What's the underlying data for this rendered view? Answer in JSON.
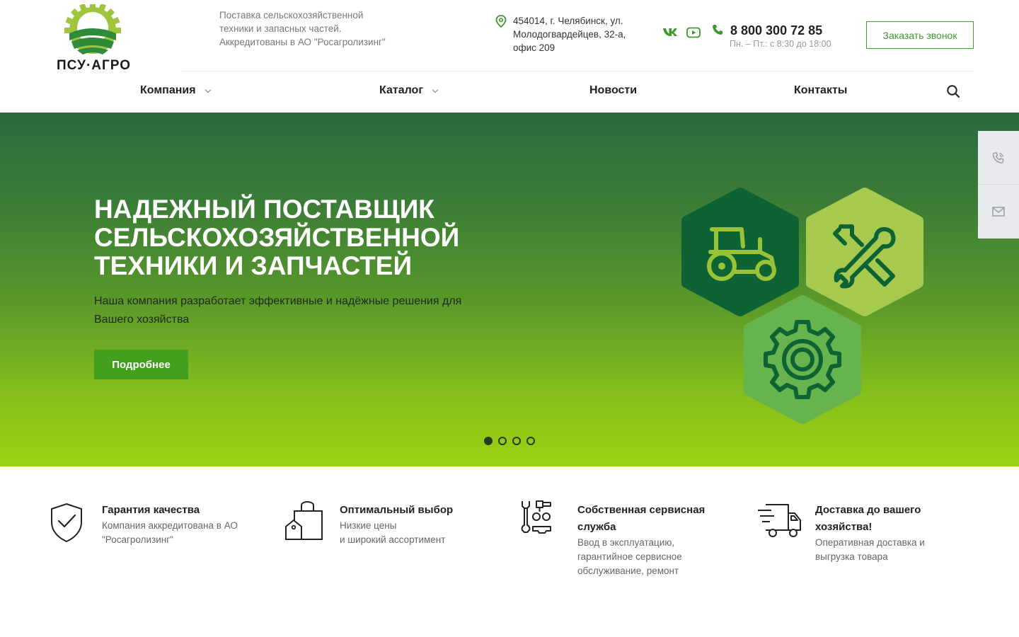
{
  "header": {
    "logo_text": "ПСУ·АГРО",
    "tagline": "Поставка сельскохозяйственной техники и запасных частей. Аккредитованы в АО \"Росагролизинг\"",
    "address": "454014, г. Челябинск, ул. Молодогвардейцев, 32-а, офис 209",
    "phone": "8 800 300 72 85",
    "hours": "Пн. – Пт.: с 8:30 до 18:00",
    "callback_label": "Заказать звонок",
    "social": [
      "vk-icon",
      "youtube-icon"
    ]
  },
  "nav": {
    "items": [
      {
        "label": "Компания",
        "has_dropdown": true
      },
      {
        "label": "Каталог",
        "has_dropdown": true
      },
      {
        "label": "Новости",
        "has_dropdown": false
      },
      {
        "label": "Контакты",
        "has_dropdown": false
      }
    ]
  },
  "hero": {
    "title": "Надежный поставщик сельскохозяйственной техники и запчастей",
    "subtitle": "Наша компания разработает эффективные и надёжные решения для Вашего хозяйства",
    "button_label": "Подробнее",
    "slides_total": 4,
    "active_slide": 1,
    "icons": [
      "tractor-icon",
      "tools-icon",
      "gear-icon"
    ]
  },
  "features": [
    {
      "title": "Гарантия качества",
      "desc": "Компания аккредитована в АО \"Росагролизинг\"",
      "icon": "shield-check-icon"
    },
    {
      "title": "Оптимальный выбор",
      "desc": "Низкие цены\nи широкий ассортимент",
      "icon": "shopping-bag-icon"
    },
    {
      "title": "Собственная сервисная служба",
      "desc": "Ввод в эксплуатацию, гарантийное сервисное обслуживание, ремонт",
      "icon": "service-tools-icon"
    },
    {
      "title": "Доставка до вашего хозяйства!",
      "desc": "Оперативная доставка и выгрузка товара",
      "icon": "delivery-truck-icon"
    }
  ],
  "colors": {
    "accent": "#3d9b2e",
    "button": "#43a01f",
    "hero_top": "#2c6a40",
    "hero_bottom": "#9dd113",
    "hex_dark": "#0e6334",
    "hex_light": "#a6c94e",
    "hex_mid": "#67b34d"
  }
}
